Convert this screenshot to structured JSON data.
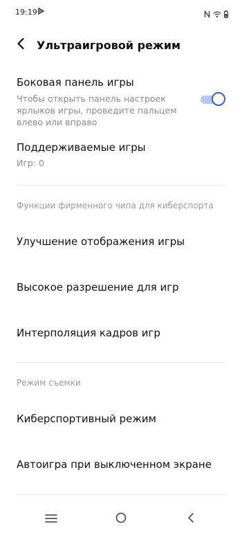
{
  "status_bar": {
    "time": "19:19",
    "icons": [
      "notification-flag-icon",
      "nfc-icon",
      "wifi-icon",
      "battery-icon"
    ]
  },
  "header": {
    "title": "Ультраигровой режим",
    "back_icon": "chevron-left-icon"
  },
  "game_panel": {
    "title": "Боковая панель игры",
    "description": "Чтобы открыть панель настроек ярлыков игры, проведите пальцем влево или вправо",
    "toggle_on": true,
    "accent_color": "#2f5df0"
  },
  "supported_games": {
    "title": "Поддерживаемые игры",
    "subtitle": "Игр: 0"
  },
  "chip_section": {
    "label": "Функции фирменного чипа для киберспорта",
    "items": [
      "Улучшение отображения игры",
      "Высокое разрешение для игр",
      "Интерполяция кадров игр"
    ]
  },
  "capture_section": {
    "label": "Режим съемки",
    "items": [
      "Киберспортивный режим",
      "Автоигра при выключенном экране"
    ]
  },
  "nav_bar": {
    "icons": [
      "menu-icon",
      "home-icon",
      "back-icon"
    ]
  }
}
